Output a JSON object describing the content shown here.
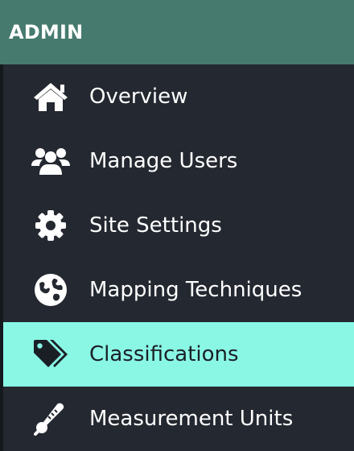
{
  "header": {
    "title": "ADMIN"
  },
  "nav": {
    "items": [
      {
        "label": "Overview",
        "icon": "home-icon"
      },
      {
        "label": "Manage Users",
        "icon": "users-icon"
      },
      {
        "label": "Site Settings",
        "icon": "gear-icon"
      },
      {
        "label": "Mapping Techniques",
        "icon": "globe-icon"
      },
      {
        "label": "Classifications",
        "icon": "tags-icon",
        "active": true
      },
      {
        "label": "Measurement Units",
        "icon": "thermometer-icon"
      }
    ]
  },
  "colors": {
    "header_bg": "#467a6e",
    "sidebar_bg": "#242830",
    "active_bg": "#8af7e5",
    "text": "#ffffff",
    "active_text": "#1a1f26"
  }
}
